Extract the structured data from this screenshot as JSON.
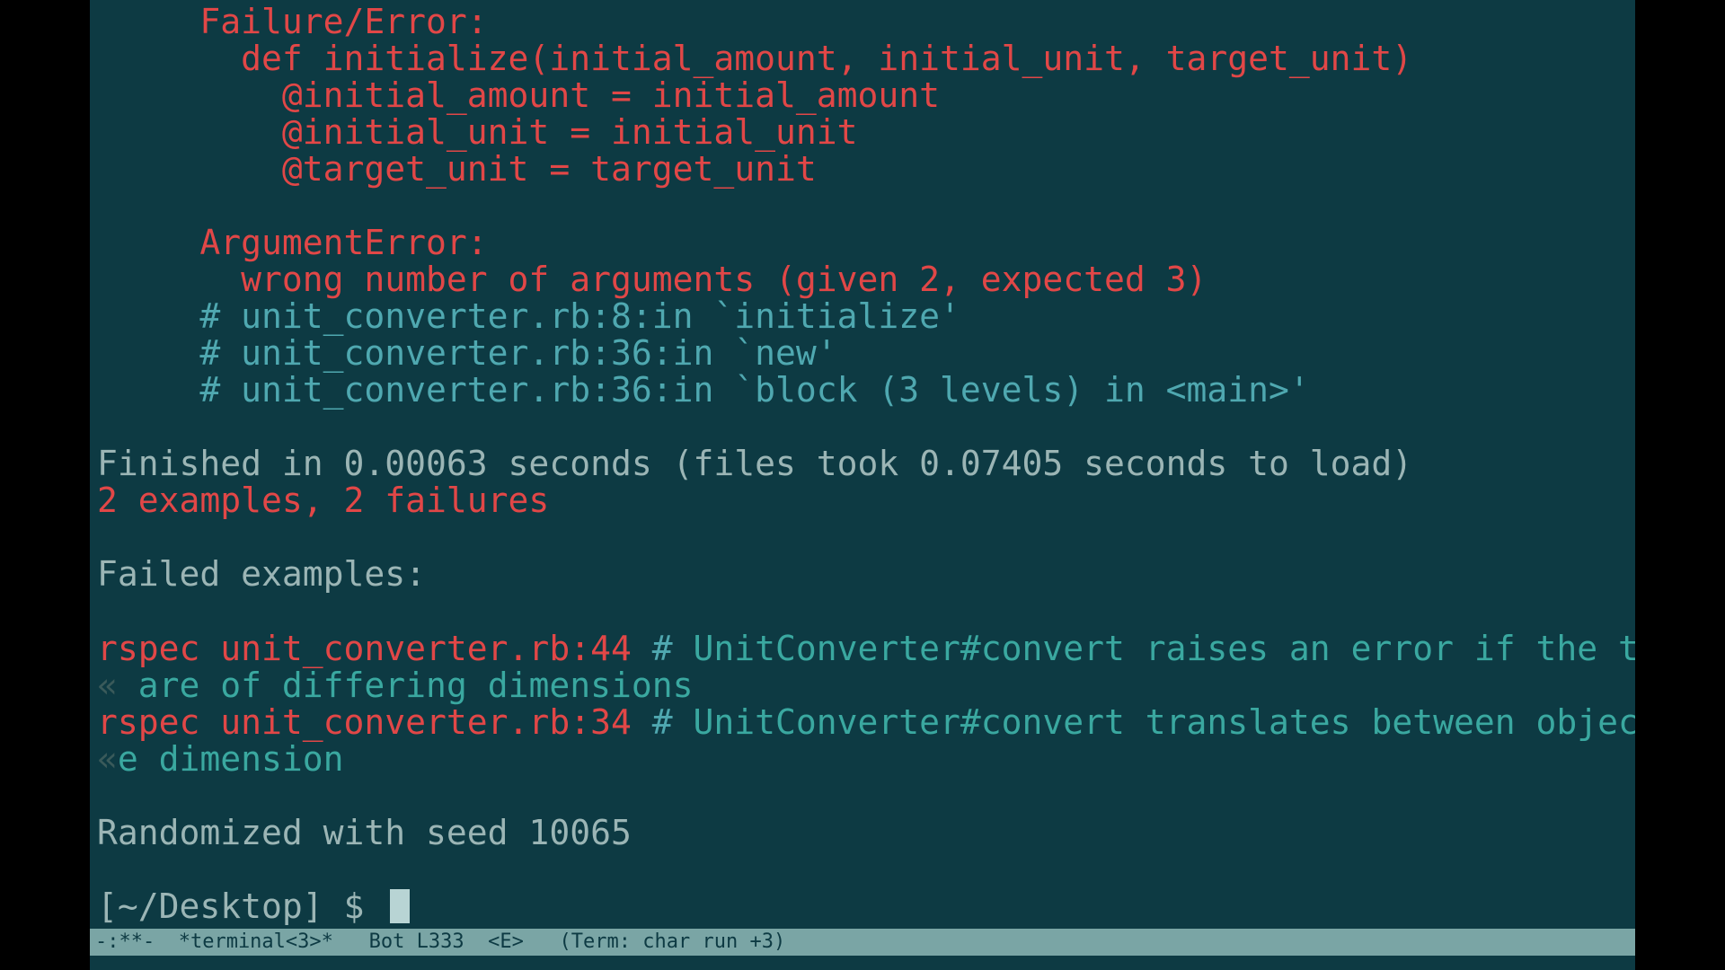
{
  "error": {
    "header": "     Failure/Error:",
    "code1": "       def initialize(initial_amount, initial_unit, target_unit)",
    "code2": "         @initial_amount = initial_amount",
    "code3": "         @initial_unit = initial_unit",
    "code4": "         @target_unit = target_unit",
    "exc_name": "     ArgumentError:",
    "exc_msg": "       wrong number of arguments (given 2, expected 3)",
    "trace1": "     # unit_converter.rb:8:in `initialize'",
    "trace2": "     # unit_converter.rb:36:in `new'",
    "trace3": "     # unit_converter.rb:36:in `block (3 levels) in <main>'"
  },
  "summary": {
    "finished": "Finished in 0.00063 seconds (files took 0.07405 seconds to load)",
    "counts": "2 examples, 2 failures",
    "failed_hdr": "Failed examples:"
  },
  "failed": {
    "f1_cmd": "rspec unit_converter.rb:44",
    "f1_sep": " # ",
    "f1_desc_a": "UnitConverter#convert raises an error if the two quantities ",
    "f1_wrap_r": "»",
    "f1_wrap_l": "«",
    "f1_desc_b": " are of differing dimensions",
    "f2_cmd": "rspec unit_converter.rb:34",
    "f2_desc_a": "UnitConverter#convert translates between objects of the sam ",
    "f2_wrap_l": "«",
    "f2_desc_b": "e dimension"
  },
  "tail": {
    "seed": "Randomized with seed 10065",
    "prompt": "[~/Desktop] $ "
  },
  "status": "-:**-  *terminal<3>*   Bot L333  <E>   (Term: char run +3)"
}
